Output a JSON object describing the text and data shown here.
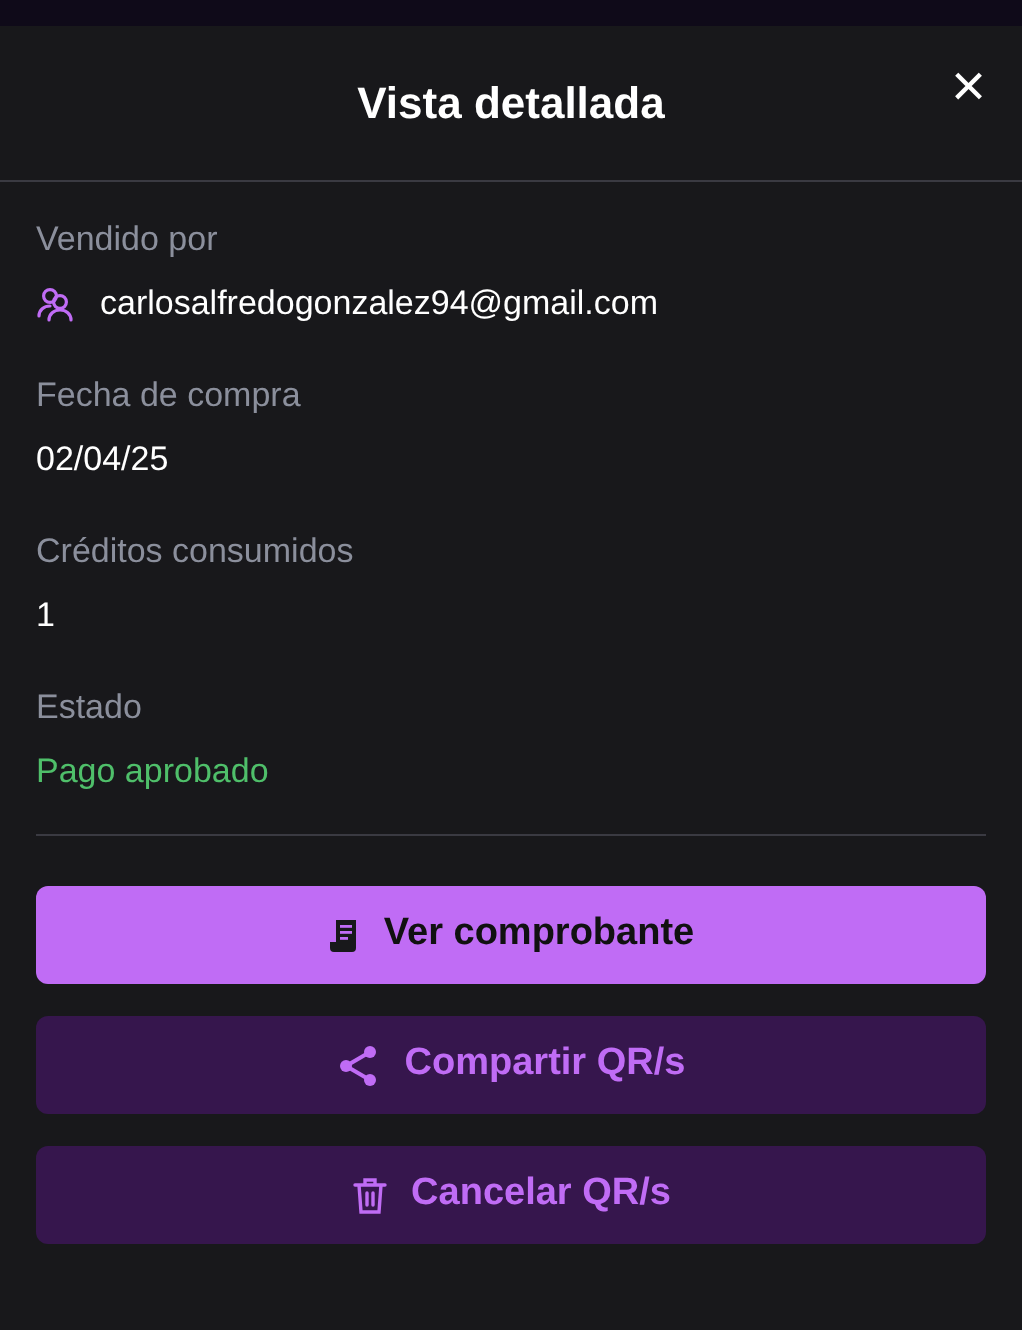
{
  "dialog": {
    "title": "Vista detallada",
    "close": "×"
  },
  "fields": [
    {
      "label": "Vendido por",
      "value": "carlosalfredogonzalez94@gmail.com",
      "kind": "user"
    },
    {
      "label": "Fecha de compra",
      "value": "02/04/25",
      "kind": "text"
    },
    {
      "label": "Créditos consumidos",
      "value": "1",
      "kind": "text"
    },
    {
      "label": "Estado",
      "value": "Pago aprobado",
      "kind": "status"
    }
  ],
  "buttons": [
    {
      "label": "Ver comprobante",
      "kind": "primary"
    },
    {
      "label": "Compartir QR/s",
      "kind": "secondary"
    },
    {
      "label": "Cancelar QR/s",
      "kind": "secondary"
    }
  ]
}
